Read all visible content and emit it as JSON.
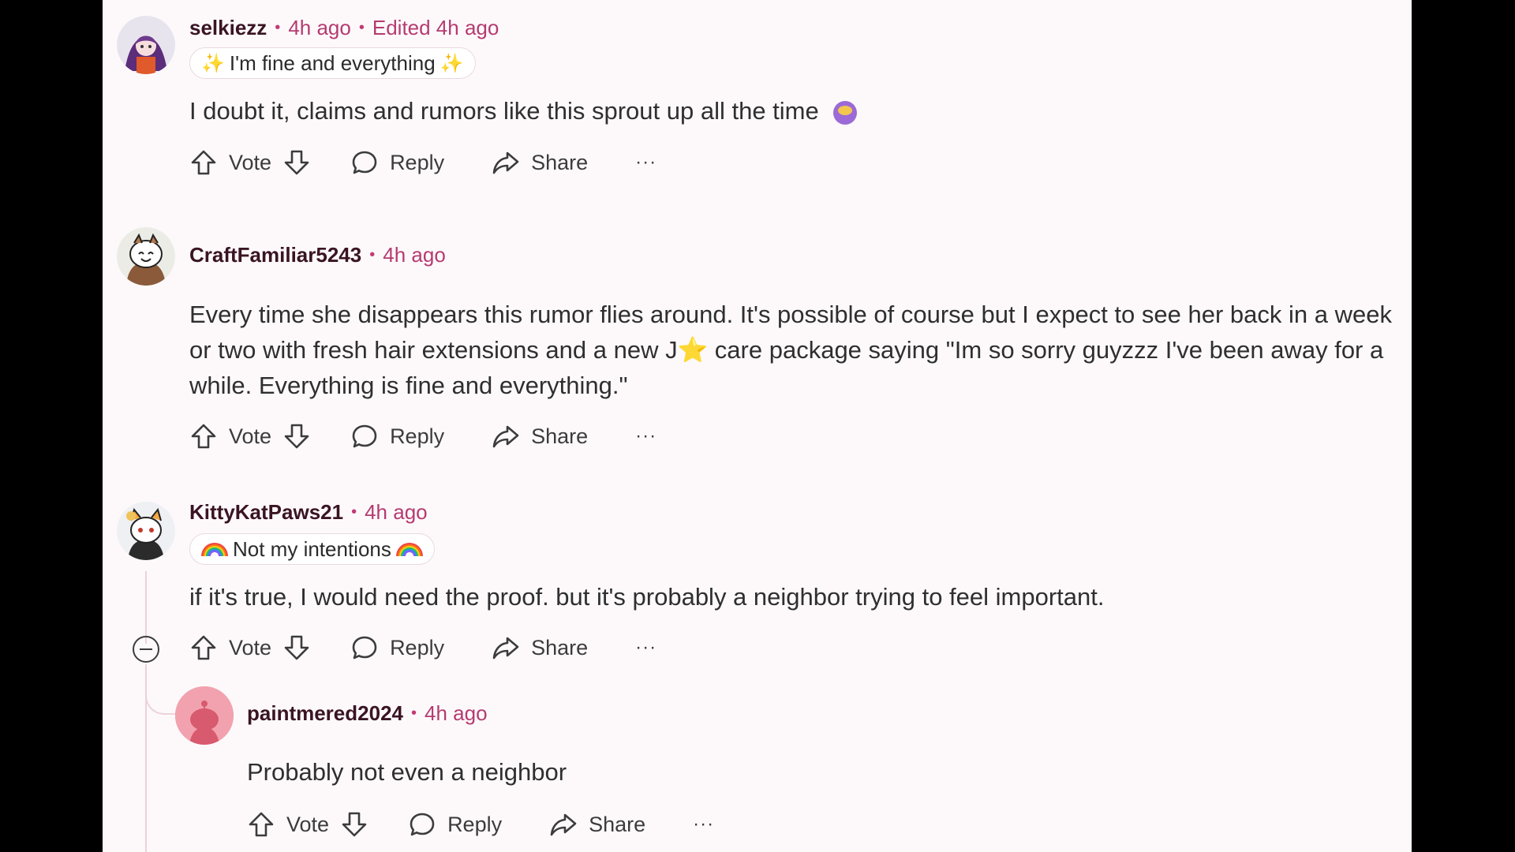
{
  "colors": {
    "accent": "#b53b70",
    "username": "#3a1422",
    "background": "#fdf9fb"
  },
  "actions": {
    "vote": "Vote",
    "reply": "Reply",
    "share": "Share",
    "more": "···"
  },
  "comments": [
    {
      "user": "selkiezz",
      "time": "4h ago",
      "edited": "Edited 4h ago",
      "flair": "I'm fine and everything",
      "text": "I doubt it, claims and rumors like this sprout up all the time"
    },
    {
      "user": "CraftFamiliar5243",
      "time": "4h ago",
      "text": "Every time she disappears this rumor flies around. It's possible of course but I expect to see her back in a week or two with fresh hair extensions and a new J⭐ care package saying \"Im so sorry guyzzz I've been away for a while. Everything is fine and everything.\""
    },
    {
      "user": "KittyKatPaws21",
      "time": "4h ago",
      "flair": "Not my intentions",
      "text": "if it's true, I would need the proof. but it's probably a neighbor trying to feel important."
    },
    {
      "user": "paintmered2024",
      "time": "4h ago",
      "text": "Probably not even a neighbor"
    }
  ]
}
